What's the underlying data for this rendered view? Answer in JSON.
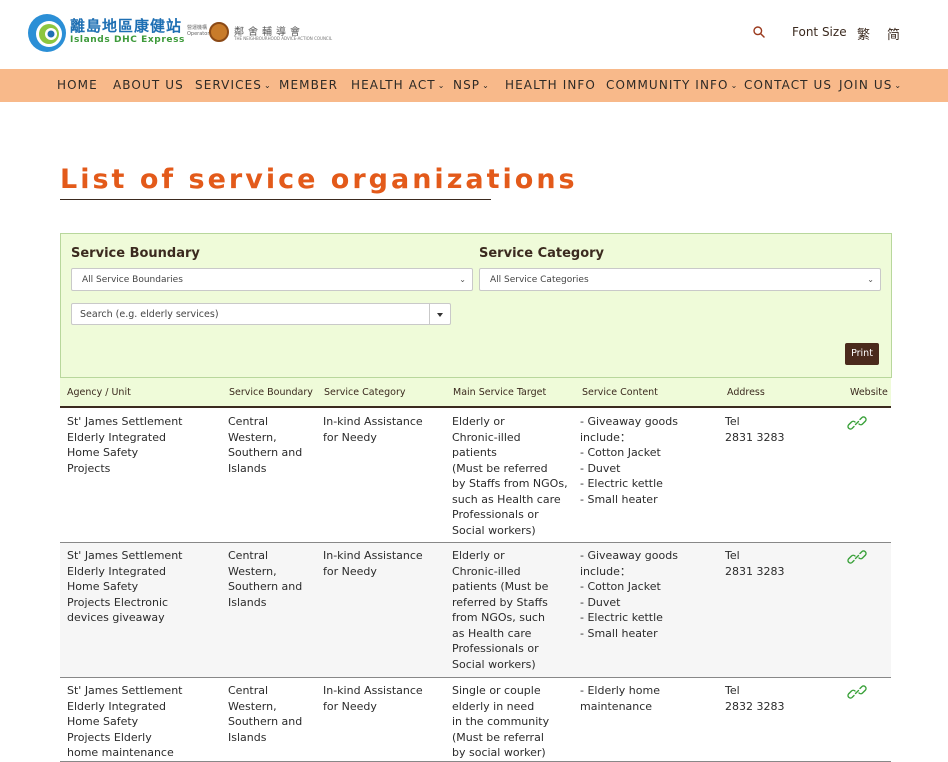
{
  "header": {
    "logo_cn": "離島地區康健站",
    "logo_en": "Islands DHC Express",
    "operator_label": "營運機構 Operator",
    "operator_cn": "鄰舍輔導會",
    "operator_en": "THE NEIGHBOURHOOD ADVICE-ACTION COUNCIL",
    "font_size_label": "Font Size",
    "lang_tc": "繁",
    "lang_sc": "简"
  },
  "nav": [
    {
      "label": "HOME"
    },
    {
      "label": "ABOUT US"
    },
    {
      "label": "SERVICES"
    },
    {
      "label": "MEMBER"
    },
    {
      "label": "HEALTH ACT"
    },
    {
      "label": "NSP"
    },
    {
      "label": "HEALTH INFO"
    },
    {
      "label": "COMMUNITY INFO"
    },
    {
      "label": "CONTACT US"
    },
    {
      "label": "JOIN US"
    }
  ],
  "page": {
    "title": "List of service organizations"
  },
  "filters": {
    "boundary_label": "Service Boundary",
    "boundary_value": "All Service Boundaries",
    "category_label": "Service Category",
    "category_value": "All Service Categories",
    "search_placeholder": "Search (e.g. elderly services)",
    "print_label": "Print"
  },
  "table": {
    "headers": [
      "Agency / Unit",
      "Service Boundary",
      "Service Category",
      "Main Service Target",
      "Service Content",
      "Address",
      "Website"
    ],
    "rows": [
      {
        "agency": [
          "St' James Settlement",
          "Elderly Integrated",
          "Home Safety",
          "Projects"
        ],
        "boundary": [
          "Central",
          "Western,",
          "Southern and",
          "Islands"
        ],
        "category": [
          "In-kind Assistance",
          "for Needy"
        ],
        "target": [
          "Elderly or",
          "Chronic-illed",
          "patients",
          "(Must be referred",
          "by Staffs from NGOs,",
          "such as Health care",
          "Professionals or",
          "Social workers)"
        ],
        "content": [
          "- Giveaway goods",
          "   include：",
          "- Cotton Jacket",
          "- Duvet",
          "- Electric kettle",
          "- Small heater"
        ],
        "address": [
          "Tel",
          "2831 3283"
        ]
      },
      {
        "agency": [
          "St' James Settlement",
          "Elderly Integrated",
          "Home Safety",
          "Projects Electronic",
          "devices giveaway"
        ],
        "boundary": [
          "Central",
          "Western,",
          "Southern and",
          "Islands"
        ],
        "category": [
          "In-kind Assistance",
          "for Needy"
        ],
        "target": [
          "Elderly or",
          "Chronic-illed",
          "patients (Must be",
          "referred by Staffs",
          "from NGOs, such",
          "as Health care",
          "Professionals or",
          "Social workers)"
        ],
        "content": [
          "- Giveaway goods",
          "   include：",
          "- Cotton Jacket",
          "- Duvet",
          "- Electric kettle",
          "- Small heater"
        ],
        "address": [
          "Tel",
          "2831 3283"
        ]
      },
      {
        "agency": [
          "St' James Settlement",
          "Elderly Integrated",
          "Home Safety",
          "Projects Elderly",
          "home maintenance"
        ],
        "boundary": [
          "Central",
          "Western,",
          "Southern and",
          "Islands"
        ],
        "category": [
          "In-kind Assistance",
          "for Needy"
        ],
        "target": [
          "Single or couple",
          "elderly in need",
          "in the community",
          "(Must be referral",
          "by social worker)"
        ],
        "content": [
          "- Elderly home",
          "   maintenance"
        ],
        "address": [
          "Tel",
          "2832 3283"
        ]
      }
    ]
  }
}
